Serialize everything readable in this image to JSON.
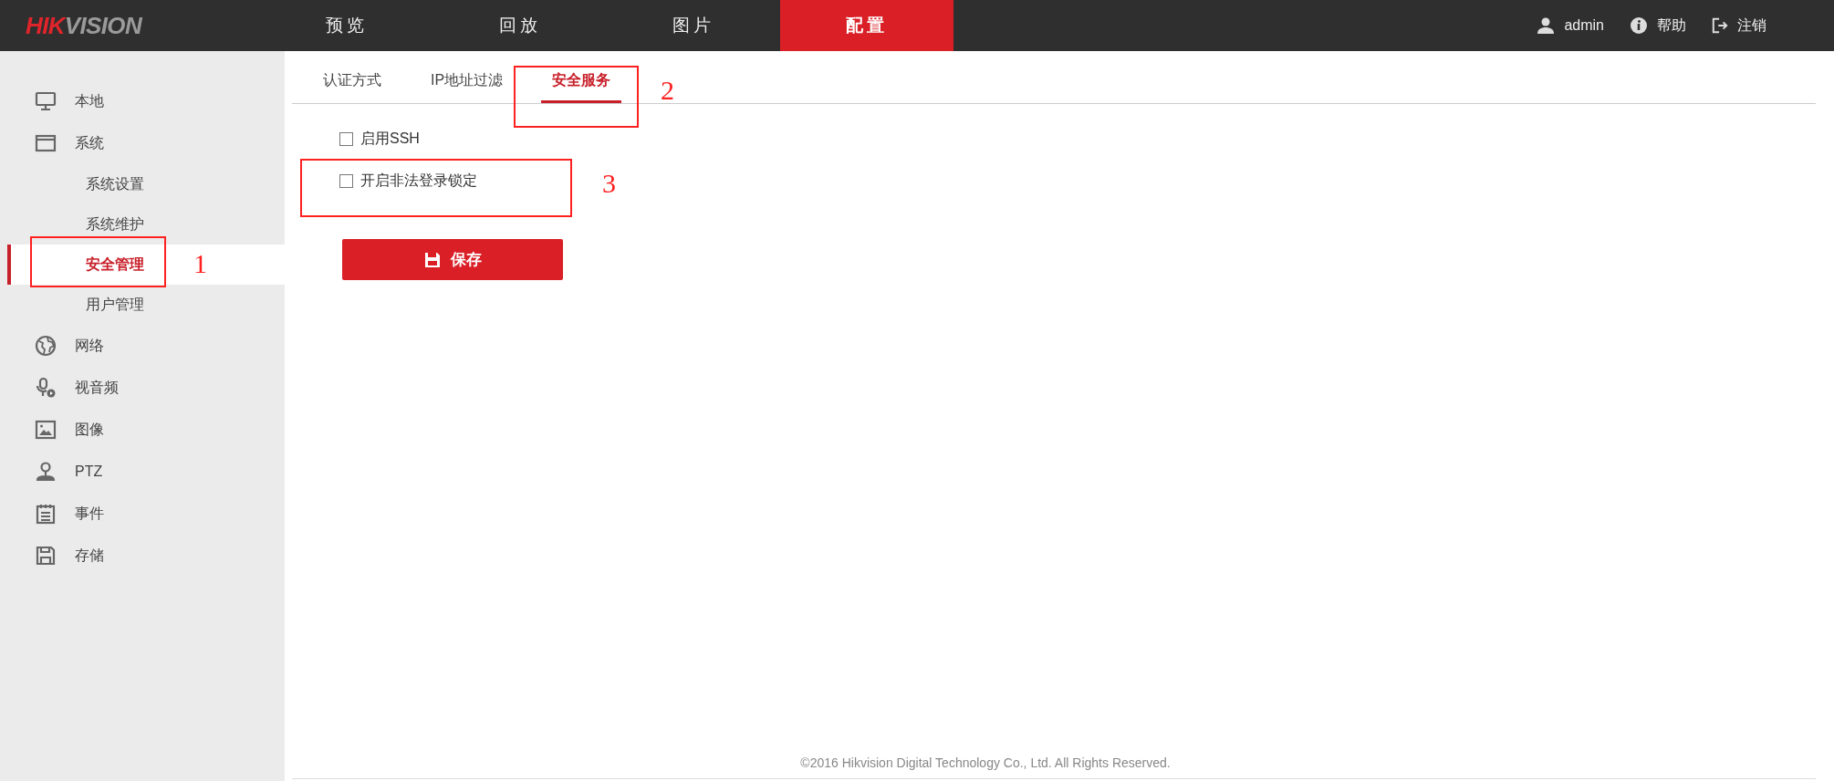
{
  "header": {
    "logo": {
      "red_part": "HIK",
      "gray_part": "VISION"
    },
    "nav": [
      {
        "label": "预览",
        "selected": false
      },
      {
        "label": "回放",
        "selected": false
      },
      {
        "label": "图片",
        "selected": false
      },
      {
        "label": "配置",
        "selected": true
      }
    ],
    "user_links": [
      {
        "kind": "user",
        "label": "admin"
      },
      {
        "kind": "help",
        "label": "帮助"
      },
      {
        "kind": "logout",
        "label": "注销"
      }
    ]
  },
  "sidebar": {
    "items": [
      {
        "kind": "local",
        "label": "本地",
        "selected": false
      },
      {
        "kind": "system",
        "label": "系统",
        "selected": false,
        "children": [
          {
            "label": "系统设置",
            "selected": false
          },
          {
            "label": "系统维护",
            "selected": false
          },
          {
            "label": "安全管理",
            "selected": true
          },
          {
            "label": "用户管理",
            "selected": false
          }
        ]
      },
      {
        "kind": "network",
        "label": "网络",
        "selected": false
      },
      {
        "kind": "audio_video",
        "label": "视音频",
        "selected": false
      },
      {
        "kind": "image",
        "label": "图像",
        "selected": false
      },
      {
        "kind": "ptz",
        "label": "PTZ",
        "selected": false
      },
      {
        "kind": "event",
        "label": "事件",
        "selected": false
      },
      {
        "kind": "storage",
        "label": "存储",
        "selected": false
      }
    ]
  },
  "tabs": [
    {
      "label": "认证方式",
      "selected": false
    },
    {
      "label": "IP地址过滤",
      "selected": false
    },
    {
      "label": "安全服务",
      "selected": true
    }
  ],
  "options": [
    {
      "label": "启用SSH",
      "checked": false
    },
    {
      "label": "开启非法登录锁定",
      "checked": false
    }
  ],
  "save_button": "保存",
  "footer": "©2016 Hikvision Digital Technology Co., Ltd. All Rights Reserved.",
  "annotations": [
    {
      "kind": "sidebar",
      "label": "1"
    },
    {
      "kind": "tab",
      "label": "2"
    },
    {
      "kind": "options",
      "label": "3"
    }
  ]
}
